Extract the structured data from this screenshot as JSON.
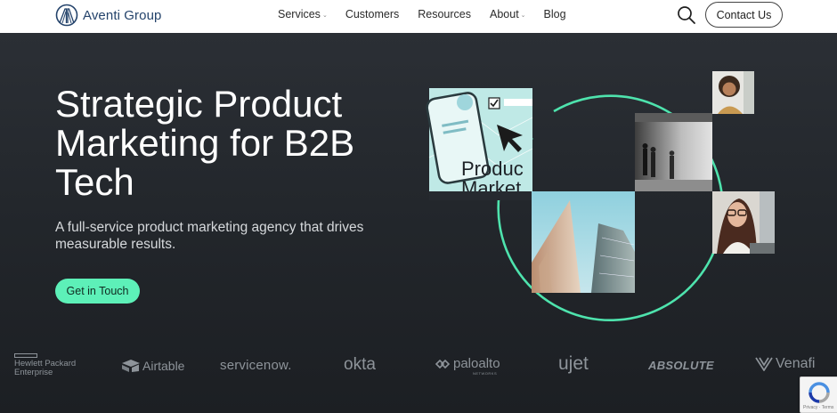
{
  "brand": {
    "name": "Aventi Group",
    "color": "#24436b"
  },
  "nav": {
    "items": [
      {
        "label": "Services",
        "has_dropdown": true
      },
      {
        "label": "Customers",
        "has_dropdown": false
      },
      {
        "label": "Resources",
        "has_dropdown": false
      },
      {
        "label": "About",
        "has_dropdown": true
      },
      {
        "label": "Blog",
        "has_dropdown": false
      }
    ],
    "search_icon": "search-icon",
    "contact_label": "Contact Us"
  },
  "hero": {
    "headline": "Strategic Product Marketing for B2B Tech",
    "subhead": "A full-service product marketing agency that drives measurable results.",
    "cta_label": "Get in Touch",
    "accent_color": "#5df0b8",
    "illustration_text": "Product Marketing"
  },
  "clients": {
    "logos": [
      {
        "name": "Hewlett Packard Enterprise",
        "line1": "Hewlett Packard",
        "line2": "Enterprise"
      },
      {
        "name": "Airtable",
        "label": "Airtable"
      },
      {
        "name": "ServiceNow",
        "label": "servicenow."
      },
      {
        "name": "Okta",
        "label": "okta"
      },
      {
        "name": "Palo Alto Networks",
        "label": "paloalto",
        "sub": "NETWORKS"
      },
      {
        "name": "UJET",
        "label": "ujet"
      },
      {
        "name": "Absolute",
        "label": "ABSOLUTE"
      },
      {
        "name": "Venafi",
        "label": "Venafi"
      }
    ]
  },
  "recaptcha": {
    "terms": "Privacy · Terms"
  }
}
